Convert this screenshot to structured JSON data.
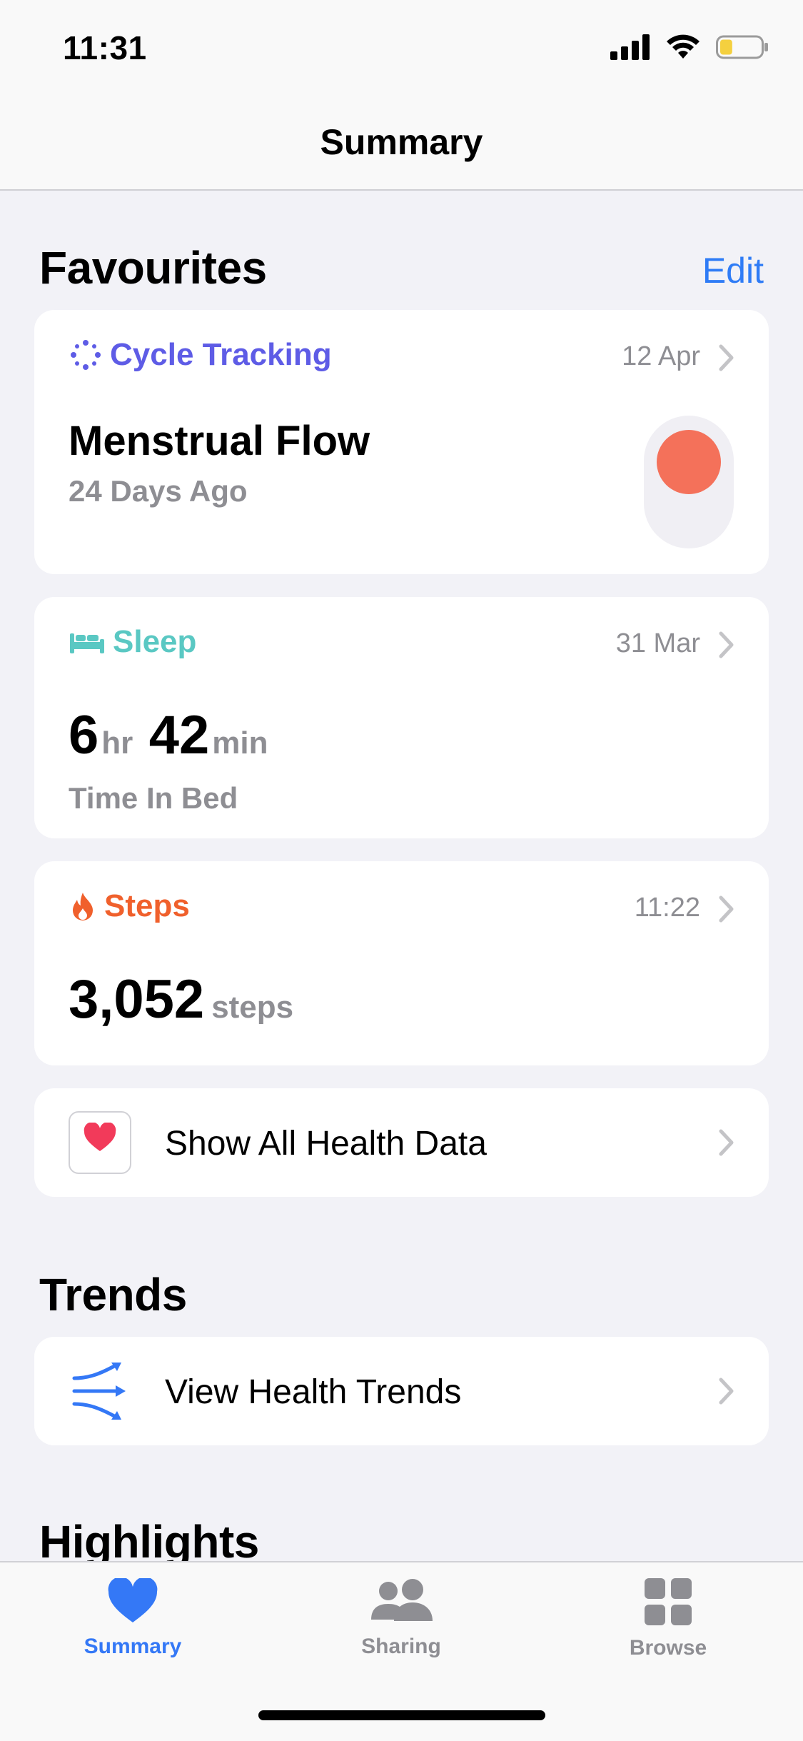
{
  "status_bar": {
    "time": "11:31",
    "battery_level": 0.3
  },
  "nav": {
    "title": "Summary"
  },
  "favourites": {
    "title": "Favourites",
    "edit_label": "Edit",
    "cycle": {
      "title": "Cycle Tracking",
      "date": "12 Apr",
      "metric": "Menstrual Flow",
      "detail": "24 Days Ago",
      "color": "#5e5ce6"
    },
    "sleep": {
      "title": "Sleep",
      "date": "31 Mar",
      "hours": "6",
      "hours_unit": "hr",
      "minutes": "42",
      "minutes_unit": "min",
      "detail": "Time In Bed",
      "color": "#5ac8c3"
    },
    "steps": {
      "title": "Steps",
      "date": "11:22",
      "value": "3,052",
      "unit": "steps",
      "color": "#f0602c"
    },
    "show_all": {
      "label": "Show All Health Data"
    }
  },
  "trends": {
    "title": "Trends",
    "view_label": "View Health Trends"
  },
  "highlights": {
    "title": "Highlights"
  },
  "tabbar": {
    "items": [
      {
        "label": "Summary",
        "icon": "heart-icon",
        "active": true
      },
      {
        "label": "Sharing",
        "icon": "people-icon",
        "active": false
      },
      {
        "label": "Browse",
        "icon": "grid-icon",
        "active": false
      }
    ],
    "active_color": "#3478f6"
  }
}
